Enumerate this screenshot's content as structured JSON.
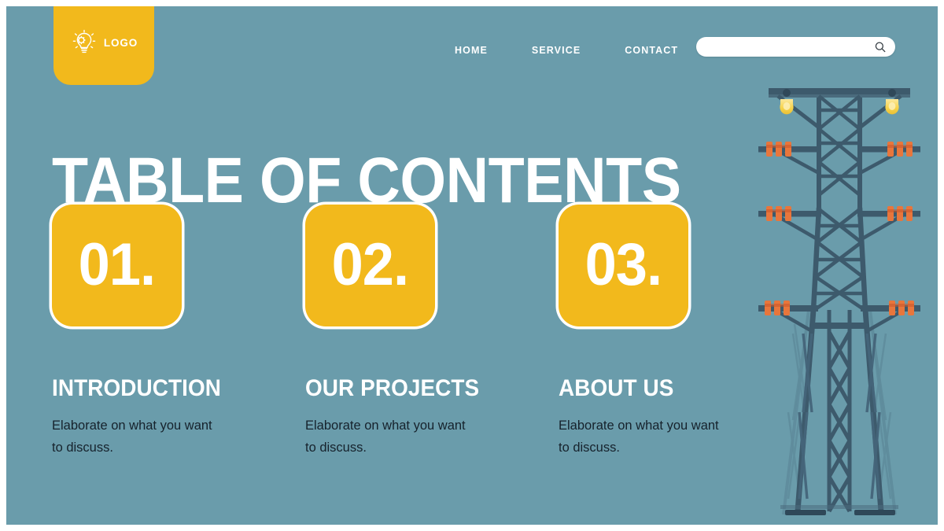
{
  "theme": {
    "background": "#6a9cab",
    "accent_yellow": "#f2b91c",
    "text_white": "#ffffff",
    "body_text": "#16222c",
    "tower_dark": "#3d5a6c",
    "tower_mid": "#4a6b7d",
    "tower_light": "#5f8c9c",
    "insulator_orange": "#e8763c",
    "lamp_yellow": "#f7d44c"
  },
  "header": {
    "logo": {
      "icon": "lightbulb-gear-icon",
      "label": "LOGO"
    },
    "nav": [
      {
        "label": "HOME"
      },
      {
        "label": "SERVICE"
      },
      {
        "label": "CONTACT"
      }
    ],
    "search": {
      "value": "",
      "placeholder": "",
      "icon": "search-icon"
    }
  },
  "main": {
    "title": "TABLE OF CONTENTS",
    "items": [
      {
        "number": "01.",
        "heading": "INTRODUCTION",
        "body": "Elaborate on what you want to discuss."
      },
      {
        "number": "02.",
        "heading": "OUR PROJECTS",
        "body": "Elaborate on what you want to discuss."
      },
      {
        "number": "03.",
        "heading": "ABOUT US",
        "body": "Elaborate on what you want to discuss."
      }
    ]
  },
  "illustration": {
    "name": "electricity-transmission-tower-illustration"
  }
}
